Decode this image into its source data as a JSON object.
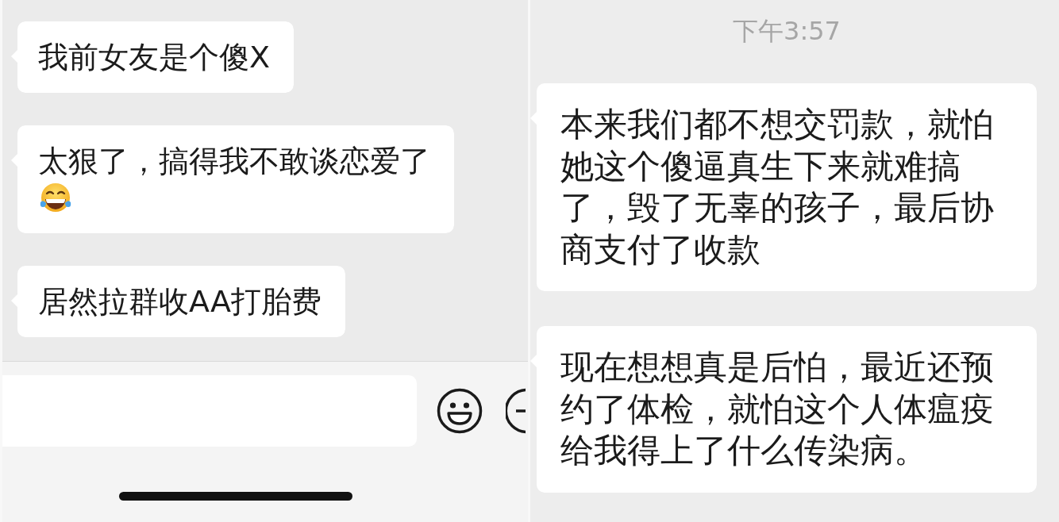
{
  "left_chat": {
    "messages": [
      {
        "kind": "text",
        "text": "我前女友是个傻X"
      },
      {
        "kind": "text-with-emoji",
        "text": "太狠了，搞得我不敢谈恋爱了"
      },
      {
        "kind": "text",
        "text": "居然拉群收AA打胎费"
      }
    ]
  },
  "right_chat": {
    "timestamp": "下午3:57",
    "messages": [
      {
        "text": "本来我们都不想交罚款，就怕她这个傻逼真生下来就难搞了，毁了无辜的孩子，最后协商支付了收款"
      },
      {
        "text": "现在想想真是后怕，最近还预约了体检，就怕这个人体瘟疫给我得上了什么传染病。"
      }
    ]
  }
}
